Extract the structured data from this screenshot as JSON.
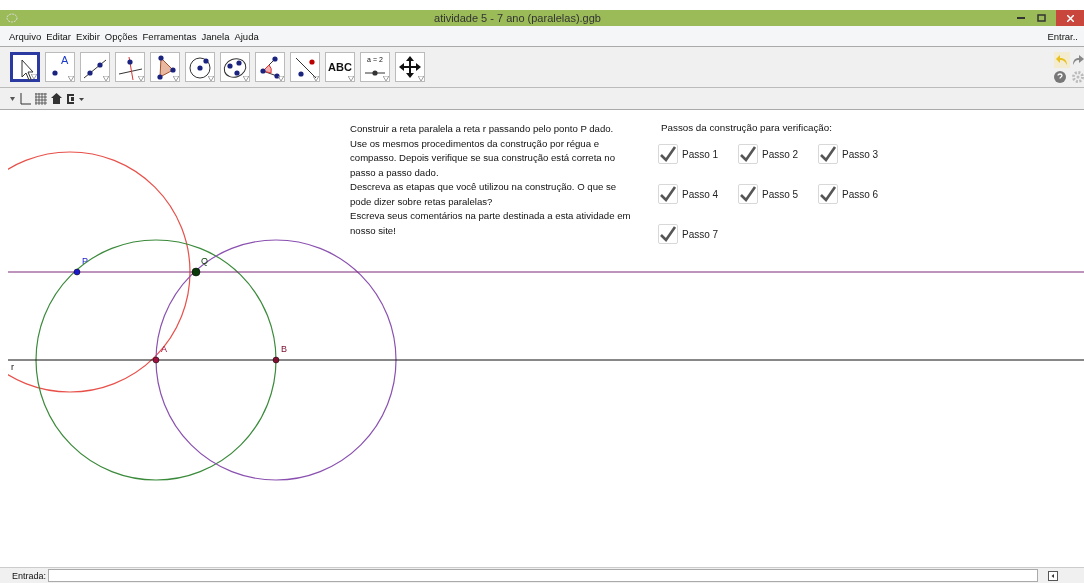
{
  "window": {
    "title": "atividade 5 - 7 ano (paralelas).ggb"
  },
  "menu": [
    "Arquivo",
    "Editar",
    "Exibir",
    "Opções",
    "Ferramentas",
    "Janela",
    "Ajuda"
  ],
  "login": "Entrar..",
  "tools": [
    {
      "kind": "move",
      "selected": true
    },
    {
      "kind": "point",
      "label": "A",
      "selected": false
    },
    {
      "kind": "line",
      "selected": false
    },
    {
      "kind": "perpendicular",
      "selected": false
    },
    {
      "kind": "polygon",
      "selected": false
    },
    {
      "kind": "circle",
      "selected": false
    },
    {
      "kind": "conic",
      "selected": false
    },
    {
      "kind": "angle",
      "selected": false
    },
    {
      "kind": "reflect",
      "selected": false
    },
    {
      "kind": "text",
      "label": "ABC",
      "selected": false
    },
    {
      "kind": "slider",
      "label": "a = 2",
      "selected": false
    },
    {
      "kind": "move_view",
      "selected": false
    }
  ],
  "instructions": [
    "Construir a reta paralela a reta r passando pelo ponto P dado.",
    "Use os mesmos procedimentos da construção por régua e compasso. Depois verifique se sua construção está correta no passo a passo dado.",
    "Descreva as etapas que você utilizou na construção. O que se pode dizer sobre retas paralelas?",
    "Escreva seus comentários na parte destinada a esta atividade em nosso site!"
  ],
  "steps_title": "Passos da construção para verificação:",
  "steps": [
    {
      "label": "Passo 1",
      "checked": true
    },
    {
      "label": "Passo 2",
      "checked": true
    },
    {
      "label": "Passo 3",
      "checked": true
    },
    {
      "label": "Passo 4",
      "checked": true
    },
    {
      "label": "Passo 5",
      "checked": true
    },
    {
      "label": "Passo 6",
      "checked": true
    },
    {
      "label": "Passo 7",
      "checked": true
    }
  ],
  "points": [
    {
      "label": "P",
      "color": "#1a1acc"
    },
    {
      "label": "Q",
      "color": "#0a3a0a"
    },
    {
      "label": "A",
      "color": "#a01040"
    },
    {
      "label": "B",
      "color": "#801030"
    }
  ],
  "line_label": "r",
  "input_bar": {
    "label": "Entrada:"
  }
}
